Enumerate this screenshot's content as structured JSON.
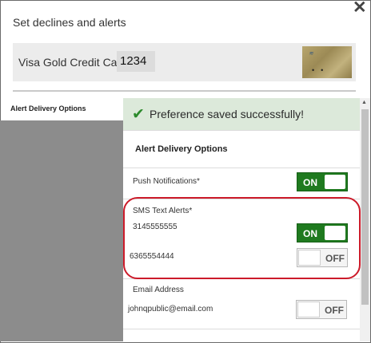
{
  "header": {
    "title": "Set declines and alerts",
    "close_icon": "close-icon"
  },
  "card": {
    "name": "Visa Gold Credit Card*",
    "last4": "1234"
  },
  "sidebar": {
    "label": "Alert Delivery Options"
  },
  "panel": {
    "success_message": "Preference saved successfully!",
    "section_title": "Alert Delivery Options",
    "push": {
      "label": "Push Notifications*",
      "toggle": "ON"
    },
    "sms": {
      "label": "SMS Text Alerts*",
      "numbers": [
        {
          "number": "3145555555",
          "toggle": "ON"
        },
        {
          "number": "6365554444",
          "toggle": "OFF"
        }
      ]
    },
    "email": {
      "label": "Email Address",
      "address": "johnqpublic@email.com",
      "toggle": "OFF"
    }
  },
  "colors": {
    "toggle_on": "#1f7a1f",
    "success_bg": "#dce9da",
    "highlight": "#cc1b2a"
  }
}
